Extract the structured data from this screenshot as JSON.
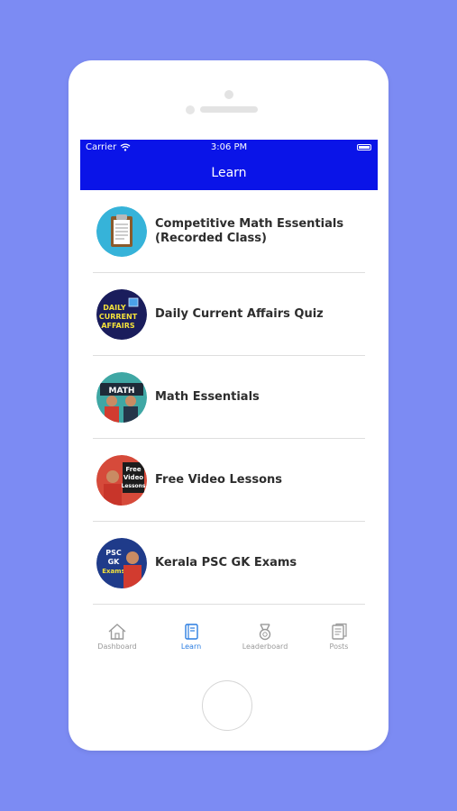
{
  "status_bar": {
    "carrier": "Carrier",
    "time": "3:06 PM"
  },
  "header": {
    "title": "Learn"
  },
  "courses": [
    {
      "label": "Competitive Math Essentials (Recorded Class)",
      "icon": "clipboard-icon"
    },
    {
      "label": "Daily Current Affairs Quiz",
      "icon": "daily-current-affairs-thumbnail",
      "thumb_text": [
        "DAILY",
        "CURRENT",
        "AFFAIRS"
      ]
    },
    {
      "label": "Math Essentials",
      "icon": "math-essentials-thumbnail",
      "thumb_text": "MATH"
    },
    {
      "label": "Free Video Lessons",
      "icon": "free-video-lessons-thumbnail",
      "thumb_text": [
        "Free",
        "Video",
        "Lessons"
      ]
    },
    {
      "label": "Kerala PSC GK Exams",
      "icon": "psc-gk-exams-thumbnail",
      "thumb_text": [
        "PSC",
        "GK",
        "Exams"
      ]
    }
  ],
  "tabbar": [
    {
      "label": "Dashboard",
      "icon": "home-icon",
      "active": false
    },
    {
      "label": "Learn",
      "icon": "book-icon",
      "active": true
    },
    {
      "label": "Leaderboard",
      "icon": "medal-icon",
      "active": false
    },
    {
      "label": "Posts",
      "icon": "posts-icon",
      "active": false
    }
  ],
  "colors": {
    "background": "#7c8bf3",
    "navbar": "#0a14e8",
    "active_tab": "#2a7de1",
    "inactive_tab": "#9a9a9a"
  }
}
